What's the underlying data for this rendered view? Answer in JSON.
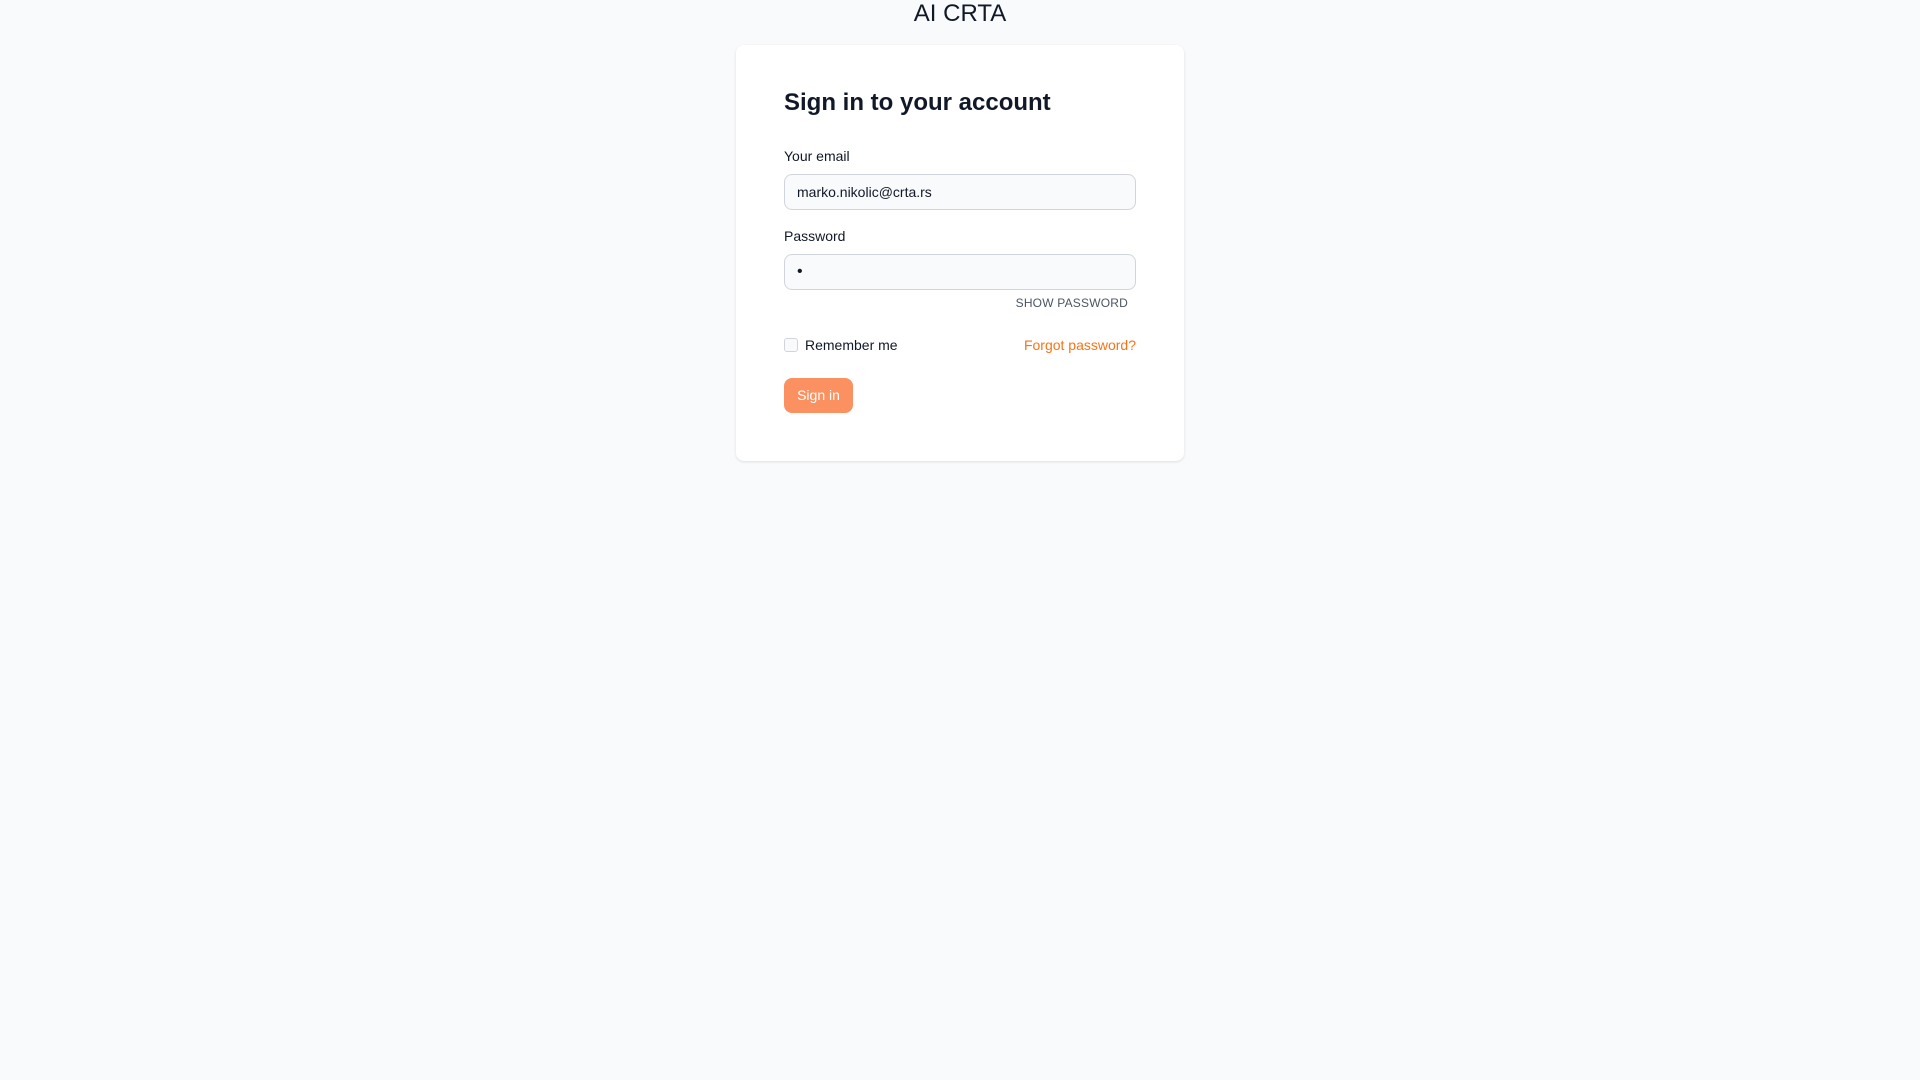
{
  "app": {
    "brand": "AI CRTA"
  },
  "login": {
    "title": "Sign in to your account",
    "email_label": "Your email",
    "email_value": "marko.nikolic@crta.rs",
    "password_label": "Password",
    "password_value": "•",
    "show_password": "SHOW PASSWORD",
    "remember_label": "Remember me",
    "remember_checked": false,
    "forgot_link": "Forgot password?",
    "submit_label": "Sign in"
  },
  "colors": {
    "accent": "#f97316",
    "button": "#fb9161",
    "background": "#f9fafb"
  }
}
